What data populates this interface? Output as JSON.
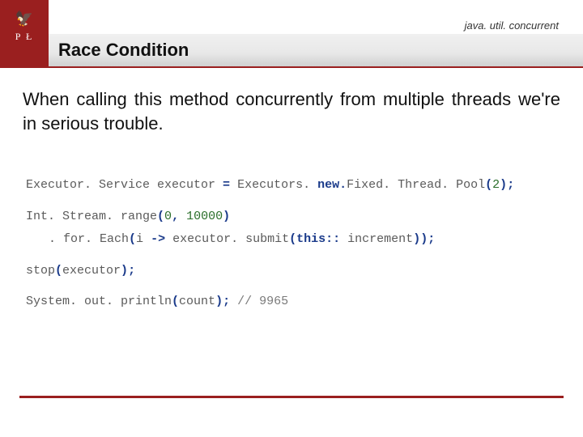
{
  "header": {
    "breadcrumb": "java. util. concurrent",
    "title": "Race Condition",
    "logo_top": "🦅",
    "logo_bottom": "P  Ł"
  },
  "body": {
    "lead": "When calling this method concurrently from multiple threads we're in serious trouble."
  },
  "code": {
    "l1a": "Executor. Service executor ",
    "l1b": "=",
    "l1c": " Executors. ",
    "l1d": "new.",
    "l1e": "Fixed. Thread. Pool",
    "l1f": "(",
    "l1g": "2",
    "l1h": ")",
    "l1i": ";",
    "l2a": "Int. Stream. range",
    "l2b": "(",
    "l2c": "0",
    "l2d": ",",
    "l2e": " ",
    "l2f": "10000",
    "l2g": ")",
    "l3a": ". for. Each",
    "l3b": "(",
    "l3c": "i ",
    "l3d": "->",
    "l3e": " executor. submit",
    "l3f": "(",
    "l3g": "this",
    "l3h": ":",
    "l3i": ":",
    "l3j": " increment",
    "l3k": "))",
    "l3l": ";",
    "l4a": "stop",
    "l4b": "(",
    "l4c": "executor",
    "l4d": ")",
    "l4e": ";",
    "l5a": "System. out. println",
    "l5b": "(",
    "l5c": "count",
    "l5d": ")",
    "l5e": ";",
    "l5f": "  ",
    "l5g": "// 9965"
  }
}
